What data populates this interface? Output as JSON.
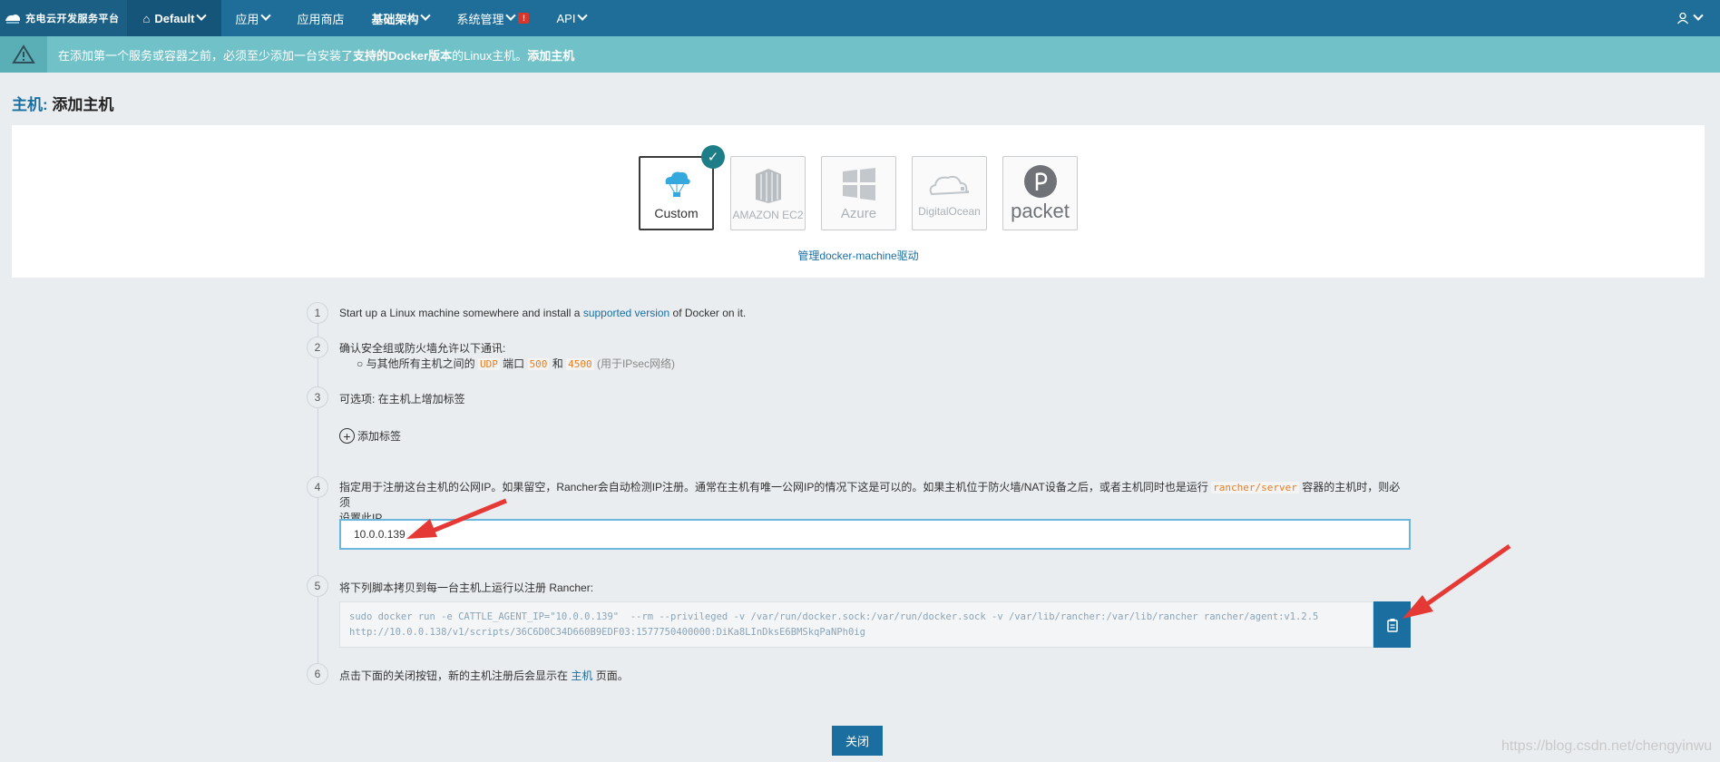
{
  "topnav": {
    "brand": "充电云开发服务平台",
    "env": "Default",
    "items": [
      {
        "label": "应用",
        "dropdown": true
      },
      {
        "label": "应用商店",
        "dropdown": false
      },
      {
        "label": "基础架构",
        "dropdown": true
      },
      {
        "label": "系统管理",
        "dropdown": true
      },
      {
        "label": "API",
        "dropdown": true
      }
    ],
    "alert_badge": "!"
  },
  "banner": {
    "text_before": "在添加第一个服务或容器之前，必须至少添加一台安装了",
    "link1": "支持的Docker版本",
    "text_after": "的Linux主机。",
    "link2": "添加主机"
  },
  "page": {
    "crumb": "主机:",
    "title": "添加主机"
  },
  "drivers": {
    "items": [
      {
        "name": "custom",
        "label": "Custom",
        "selected": true
      },
      {
        "name": "amazon-ec2",
        "label": "AMAZON EC2",
        "selected": false
      },
      {
        "name": "azure",
        "label": "Azure",
        "selected": false
      },
      {
        "name": "digitalocean",
        "label": "DigitalOcean",
        "selected": false
      },
      {
        "name": "packet",
        "label": "packet",
        "selected": false
      }
    ],
    "manage_link": "管理docker-machine驱动"
  },
  "steps": {
    "s1": {
      "num": "1",
      "pre": "Start up a Linux machine somewhere and install a ",
      "link": "supported version",
      "mid": " of Docker on it.",
      "post": ""
    },
    "s2": {
      "num": "2",
      "text": "确认安全组或防火墙允许以下通讯:",
      "bullet_pre": "与其他所有主机之间的",
      "proto": "UDP",
      "port_word": "端口",
      "port1": "500",
      "and": "和",
      "port2": "4500",
      "note": "(用于IPsec网络)"
    },
    "s3": {
      "num": "3",
      "text": "可选项: 在主机上增加标签",
      "add_label": "添加标签"
    },
    "s4": {
      "num": "4",
      "text_a": "指定用于注册这台主机的公网IP。如果留空，Rancher会自动检测IP注册。通常在主机有唯一公网IP的情况下这是可以的。如果主机位于防火墙/NAT设备之后，或者主机同时也是运行",
      "code": "rancher/server",
      "text_b": "容器的主机时，则必须",
      "text_c": "设置此IP。",
      "ip_value": "10.0.0.139"
    },
    "s5": {
      "num": "5",
      "text": "将下列脚本拷贝到每一台主机上运行以注册 Rancher:",
      "code_line1": "sudo docker run -e CATTLE_AGENT_IP=\"10.0.0.139\"  --rm --privileged -v /var/run/docker.sock:/var/run/docker.sock -v /var/lib/rancher:/var/lib/rancher rancher/agent:v1.2.5",
      "code_line2": "http://10.0.0.138/v1/scripts/36C6D0C34D660B9EDF03:1577750400000:DiKa8LInDksE6BMSkqPaNPh0ig"
    },
    "s6": {
      "num": "6",
      "pre": "点击下面的关闭按钮，新的主机注册后会显示在 ",
      "link": "主机",
      "post": " 页面。"
    }
  },
  "close_button": "关闭",
  "watermark": "https://blog.csdn.net/chengyinwu",
  "colors": {
    "nav": "#1e6e99",
    "banner": "#71c2c8",
    "accent": "#1a6fa0",
    "arrow": "#e53935"
  }
}
